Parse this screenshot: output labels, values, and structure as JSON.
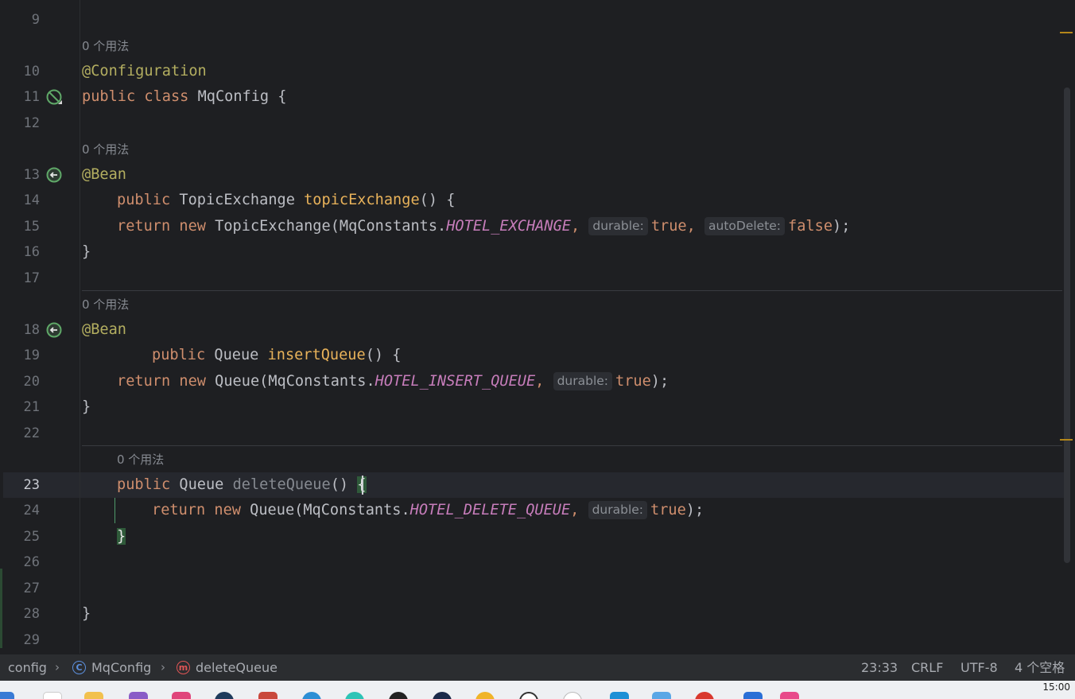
{
  "editor": {
    "line_numbers": [
      "9",
      "10",
      "11",
      "12",
      "13",
      "14",
      "15",
      "16",
      "17",
      "18",
      "19",
      "20",
      "21",
      "22",
      "23",
      "24",
      "25",
      "26",
      "27",
      "28",
      "29"
    ],
    "current_line": "23",
    "usage_hint": "0 个用法",
    "code": {
      "l10_annotation": "@Configuration",
      "l11_public": "public",
      "l11_class": "class",
      "l11_name": "MqConfig {",
      "bean": "@Bean",
      "l14_public": "public",
      "l14_type": "TopicExchange",
      "l14_method": "topicExchange",
      "l14_tail": "() {",
      "return": "return",
      "new": "new",
      "l15_class": "TopicExchange(MqConstants.",
      "l15_const": "HOTEL_EXCHANGE",
      "comma": ",",
      "hint_durable": "durable:",
      "hint_autodelete": "autoDelete:",
      "true": "true",
      "false": "false",
      "close_paren": ");",
      "close_brace": "}",
      "l19_public": "public",
      "l19_type": "Queue",
      "l19_method": "insertQueue",
      "l19_tail": "() {",
      "l20_class": "Queue(MqConstants.",
      "l20_const": "HOTEL_INSERT_QUEUE",
      "l23_public": "public",
      "l23_type": "Queue",
      "l23_method": "deleteQueue",
      "l23_tail": "()",
      "open_brace": "{",
      "l24_class": "Queue(MqConstants.",
      "l24_const": "HOTEL_DELETE_QUEUE"
    }
  },
  "statusbar": {
    "breadcrumb": [
      "config",
      "MqConfig",
      "deleteQueue"
    ],
    "class_icon_letter": "C",
    "method_icon_letter": "m",
    "position": "23:33",
    "line_ending": "CRLF",
    "encoding": "UTF-8",
    "indent": "4 个空格"
  },
  "taskbar": {
    "clock": "15:00"
  },
  "colors": {
    "background": "#1e1f22",
    "keyword": "#cf8e6d",
    "annotation": "#b3ae60",
    "method": "#56a8f5",
    "constant": "#c77dbb",
    "warning_mark": "#b3861a"
  }
}
